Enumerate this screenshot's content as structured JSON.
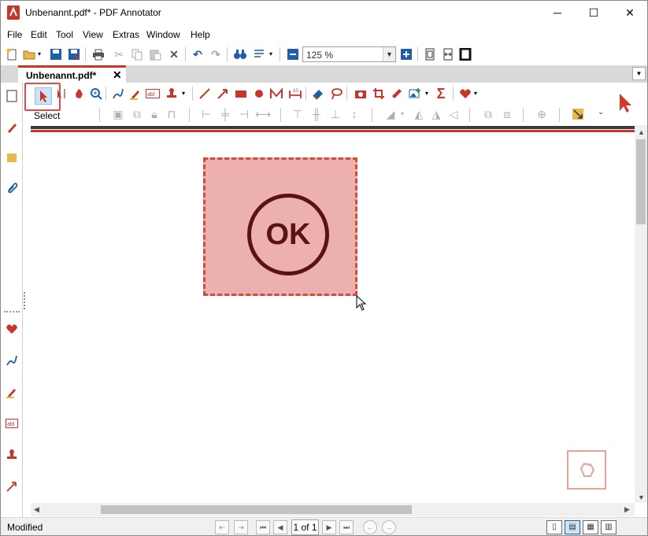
{
  "window": {
    "title": "Unbenannt.pdf* - PDF Annotator",
    "minimize": "─",
    "maximize": "☐",
    "close": "✕"
  },
  "menu": {
    "items": [
      {
        "label": "File"
      },
      {
        "label": "Edit"
      },
      {
        "label": "Tool"
      },
      {
        "label": "View"
      },
      {
        "label": "Extras"
      },
      {
        "label": "Window"
      },
      {
        "label": "Help"
      }
    ]
  },
  "toolbar": {
    "zoom_value": "125 %",
    "zoom_arrow": "▼",
    "zoom_out": "−",
    "zoom_in": "+"
  },
  "tabs": {
    "document_tab": "Unbenannt.pdf*",
    "close": "✕",
    "dropdown": "▼"
  },
  "ribbon": {
    "select_label": "Select",
    "expand": "⌄"
  },
  "stamp": {
    "text": "OK",
    "fill": "#ecb1ad",
    "border": "#d34a3e",
    "ink": "#5a1212"
  },
  "status": {
    "text": "Modified",
    "page_indicator": "1 of 1"
  },
  "colors": {
    "accent": "#c8362b",
    "blue": "#1e5fa8"
  }
}
